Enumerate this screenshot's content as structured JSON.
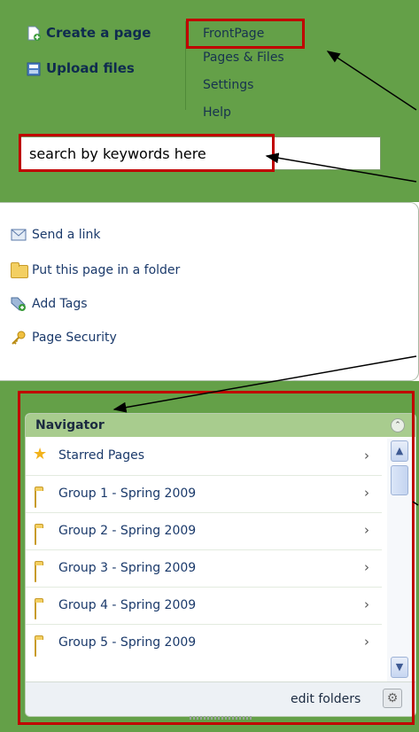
{
  "top": {
    "create_page": "Create a page",
    "upload_files": "Upload files",
    "menu": [
      "FrontPage",
      "Pages & Files",
      "Settings",
      "Help"
    ],
    "search_value": "search by keywords here"
  },
  "actions": [
    {
      "label": "Send a link",
      "icon": "envelope-icon"
    },
    {
      "label": "Put this page in a folder",
      "icon": "folder-icon"
    },
    {
      "label": "Add Tags",
      "icon": "tag-icon"
    },
    {
      "label": "Page Security",
      "icon": "key-icon"
    }
  ],
  "navigator": {
    "title": "Navigator",
    "rows": [
      {
        "label": "Starred Pages",
        "icon": "star-icon"
      },
      {
        "label": "Group 1 - Spring 2009",
        "icon": "folder-icon"
      },
      {
        "label": "Group 2 - Spring 2009",
        "icon": "folder-icon"
      },
      {
        "label": "Group 3 - Spring 2009",
        "icon": "folder-icon"
      },
      {
        "label": "Group 4 - Spring 2009",
        "icon": "folder-icon"
      },
      {
        "label": "Group 5 - Spring 2009",
        "icon": "folder-icon"
      }
    ],
    "edit_folders": "edit folders"
  },
  "colors": {
    "panel_green": "#64a048",
    "navigator_header": "#a8cc8e",
    "highlight_red": "#c00000",
    "link_blue": "#1b3a6b"
  }
}
